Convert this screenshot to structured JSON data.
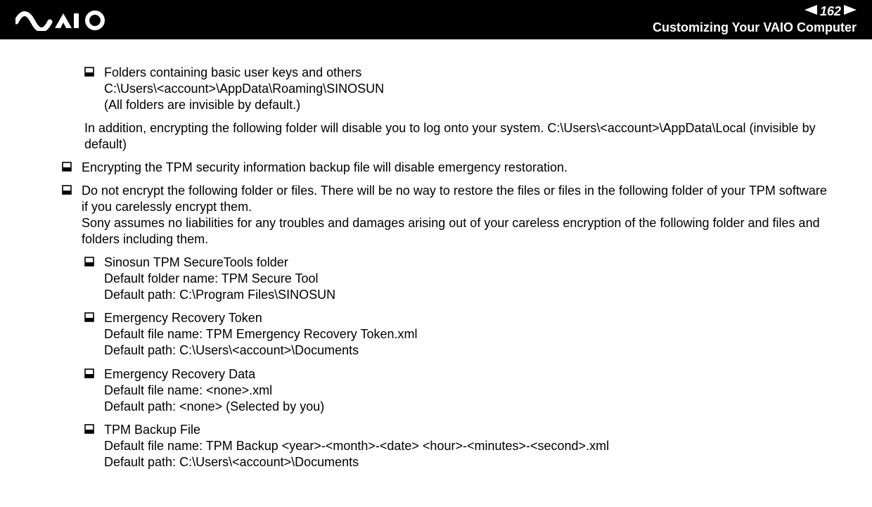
{
  "header": {
    "page_number": "162",
    "section_title": "Customizing Your VAIO Computer"
  },
  "content": {
    "nested_item_1": {
      "line1": "Folders containing basic user keys and others",
      "line2": "C:\\Users\\<account>\\AppData\\Roaming\\SINOSUN",
      "line3": "(All folders are invisible by default.)"
    },
    "plain_1": {
      "line1": "In addition, encrypting the following folder will disable you to log onto your system.",
      "line2": "C:\\Users\\<account>\\AppData\\Local (invisible by default)"
    },
    "item_2": {
      "line1": "Encrypting the TPM security information backup file will disable emergency restoration."
    },
    "item_3": {
      "line1": "Do not encrypt the following folder or files. There will be no way to restore the files or files in the following folder of your TPM software if you carelessly encrypt them.",
      "line2": "Sony assumes no liabilities for any troubles and damages arising out of your careless encryption of the following folder and files and folders including them."
    },
    "sub_items": [
      {
        "line1": "Sinosun TPM SecureTools folder",
        "line2": "Default folder name: TPM Secure Tool",
        "line3": "Default path: C:\\Program Files\\SINOSUN"
      },
      {
        "line1": "Emergency Recovery Token",
        "line2": "Default file name: TPM Emergency Recovery Token.xml",
        "line3": "Default path: C:\\Users\\<account>\\Documents"
      },
      {
        "line1": "Emergency Recovery Data",
        "line2": "Default file name: <none>.xml",
        "line3": "Default path: <none> (Selected by you)"
      },
      {
        "line1": "TPM Backup File",
        "line2": "Default file name: TPM Backup <year>-<month>-<date> <hour>-<minutes>-<second>.xml",
        "line3": "Default path: C:\\Users\\<account>\\Documents"
      }
    ]
  }
}
